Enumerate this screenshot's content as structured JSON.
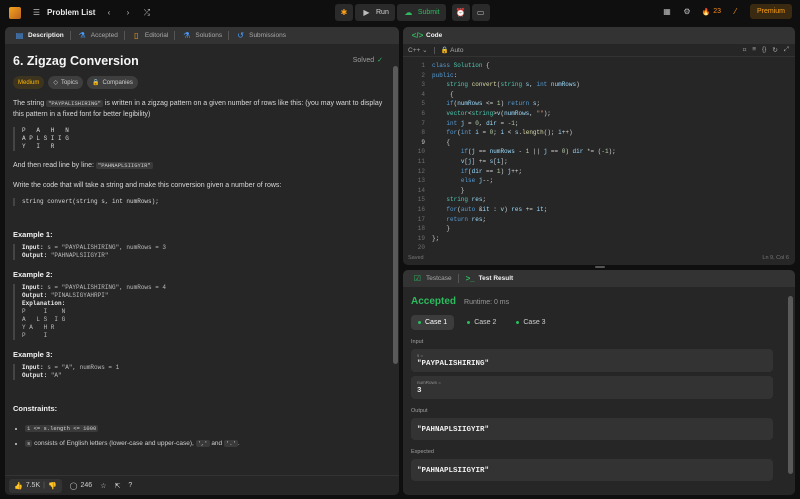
{
  "topbar": {
    "problem_list_label": "Problem List",
    "run_label": "Run",
    "submit_label": "Submit",
    "streak_count": "23",
    "premium_label": "Premium"
  },
  "left_tabs": [
    {
      "label": "Description"
    },
    {
      "label": "Accepted"
    },
    {
      "label": "Editorial"
    },
    {
      "label": "Solutions"
    },
    {
      "label": "Submissions"
    }
  ],
  "problem": {
    "title": "6. Zigzag Conversion",
    "status": "Solved",
    "difficulty": "Medium",
    "topics_label": "Topics",
    "companies_label": "Companies",
    "intro_pre": "The string ",
    "intro_code": "\"PAYPALISHIRING\"",
    "intro_post": " is written in a zigzag pattern on a given number of rows like this: (you may want to display this pattern in a fixed font for better legibility)",
    "pattern": "P   A   H   N\nA P L S I I G\nY   I   R",
    "read_pre": "And then read line by line: ",
    "read_code": "\"PAHNAPLSIIGYIR\"",
    "write_text": "Write the code that will take a string and make this conversion given a number of rows:",
    "signature": "string convert(string s, int numRows);",
    "examples": [
      {
        "heading": "Example 1:",
        "input_label": "Input:",
        "input_value": " s = \"PAYPALISHIRING\", numRows = 3",
        "output_label": "Output:",
        "output_value": " \"PAHNAPLSIIGYIR\""
      },
      {
        "heading": "Example 2:",
        "input_label": "Input:",
        "input_value": " s = \"PAYPALISHIRING\", numRows = 4",
        "output_label": "Output:",
        "output_value": " \"PINALSIGYAHRPI\"",
        "explanation_label": "Explanation:",
        "explanation": "P     I    N\nA   L S  I G\nY A   H R\nP     I"
      },
      {
        "heading": "Example 3:",
        "input_label": "Input:",
        "input_value": " s = \"A\", numRows = 1",
        "output_label": "Output:",
        "output_value": " \"A\""
      }
    ],
    "constraints_heading": "Constraints:",
    "constraint_1": "1 <= s.length <= 1000",
    "constraint_2_code": "s",
    "constraint_2_text": " consists of English letters (lower-case and upper-case), ",
    "constraint_2_code2": "','",
    "constraint_2_and": " and ",
    "constraint_2_code3": "'.'",
    "constraint_2_end": "."
  },
  "left_footer": {
    "likes": "7.5K",
    "comments": "246"
  },
  "code_panel": {
    "tab_label": "Code",
    "language": "C++",
    "mode": "Auto",
    "status_left": "Saved",
    "status_right": "Ln 9, Col 6"
  },
  "result_panel": {
    "testcase_tab": "Testcase",
    "result_tab": "Test Result",
    "verdict": "Accepted",
    "runtime": "Runtime: 0 ms",
    "cases": [
      "Case 1",
      "Case 2",
      "Case 3"
    ],
    "input_label": "Input",
    "s_name": "s =",
    "s_value": "\"PAYPALISHIRING\"",
    "rows_name": "numRows =",
    "rows_value": "3",
    "output_label": "Output",
    "output_value": "\"PAHNAPLSIIGYIR\"",
    "expected_label": "Expected",
    "expected_value": "\"PAHNAPLSIIGYIR\""
  },
  "accent_colors": {
    "accepted": "#2cbb5d",
    "premium": "#ffa116",
    "medium": "#ffb800"
  }
}
